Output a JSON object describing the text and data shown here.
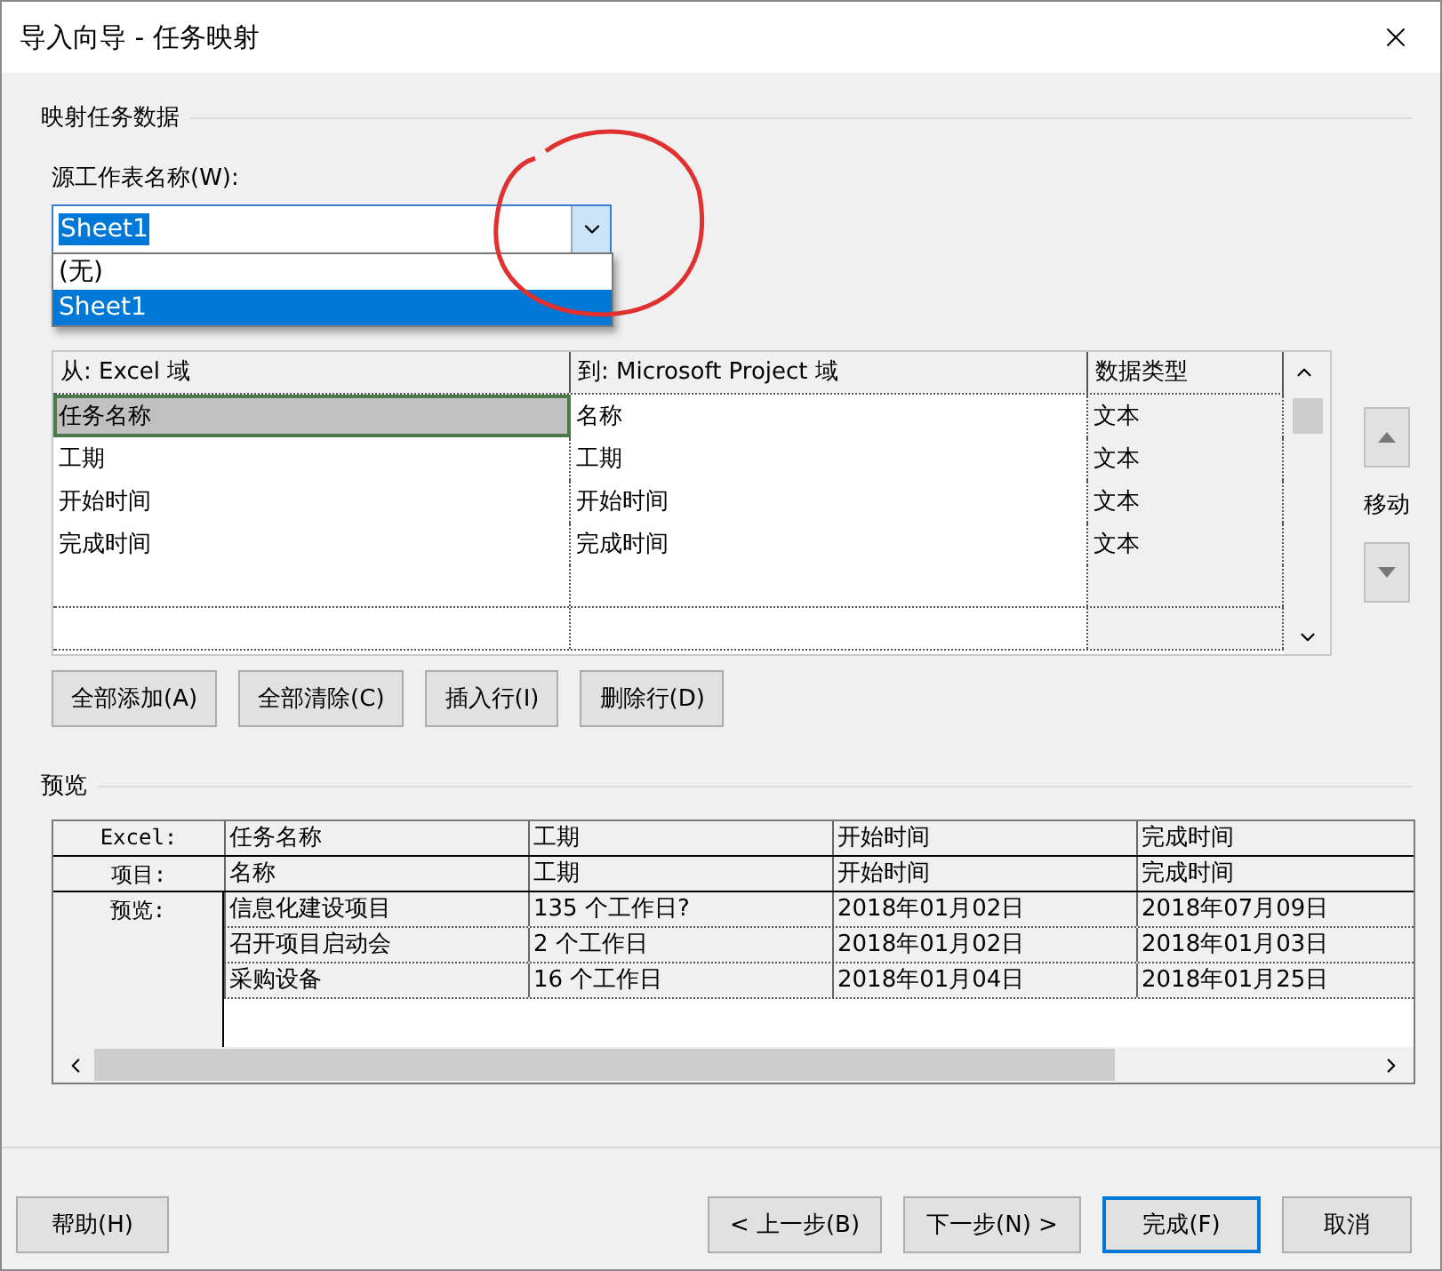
{
  "window": {
    "title": "导入向导 - 任务映射"
  },
  "mapping": {
    "heading": "映射任务数据",
    "sheet_label": "源工作表名称(W):",
    "sheet_value": "Sheet1",
    "sheet_options": [
      {
        "label": "(无)",
        "selected": false
      },
      {
        "label": "Sheet1",
        "selected": true
      }
    ],
    "columns": [
      "从: Excel 域",
      "到: Microsoft Project 域",
      "数据类型"
    ],
    "rows": [
      {
        "cells": [
          "任务名称",
          "名称",
          "文本"
        ],
        "selected": true
      },
      {
        "cells": [
          "工期",
          "工期",
          "文本"
        ],
        "selected": false
      },
      {
        "cells": [
          "开始时间",
          "开始时间",
          "文本"
        ],
        "selected": false
      },
      {
        "cells": [
          "完成时间",
          "完成时间",
          "文本"
        ],
        "selected": false
      }
    ],
    "move_label": "移动",
    "buttons": [
      "全部添加(A)",
      "全部清除(C)",
      "插入行(I)",
      "删除行(D)"
    ]
  },
  "preview": {
    "heading": "预览",
    "header_rows": [
      {
        "label": "Excel:",
        "cells": [
          "任务名称",
          "工期",
          "开始时间",
          "完成时间"
        ]
      },
      {
        "label": "项目:",
        "cells": [
          "名称",
          "工期",
          "开始时间",
          "完成时间"
        ]
      }
    ],
    "data_label": "预览:",
    "rows": [
      [
        "信息化建设项目",
        "135 个工作日?",
        "2018年01月02日",
        "2018年07月09日"
      ],
      [
        "召开项目启动会",
        "2 个工作日",
        "2018年01月02日",
        "2018年01月03日"
      ],
      [
        "采购设备",
        "16 个工作日",
        "2018年01月04日",
        "2018年01月25日"
      ]
    ]
  },
  "footer": [
    {
      "label": "帮助(H)",
      "focused": false
    },
    {
      "label": "< 上一步(B)",
      "focused": false
    },
    {
      "label": "下一步(N) >",
      "focused": false
    },
    {
      "label": "完成(F)",
      "focused": true
    },
    {
      "label": "取消",
      "focused": false
    }
  ]
}
